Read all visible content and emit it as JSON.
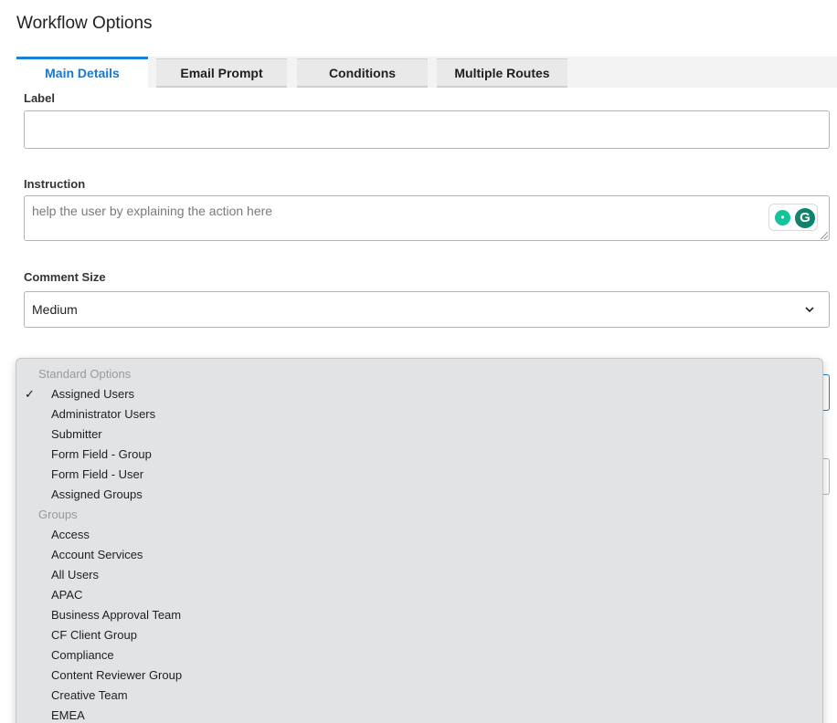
{
  "page": {
    "title": "Workflow Options"
  },
  "tabs": [
    {
      "label": "Main Details",
      "active": true
    },
    {
      "label": "Email Prompt",
      "active": false
    },
    {
      "label": "Conditions",
      "active": false
    },
    {
      "label": "Multiple Routes",
      "active": false
    }
  ],
  "form": {
    "label_field": {
      "label": "Label",
      "value": ""
    },
    "instruction_field": {
      "label": "Instruction",
      "placeholder": "help the user by explaining the action here"
    },
    "comment_size": {
      "label": "Comment Size",
      "value": "Medium"
    }
  },
  "dropdown": {
    "groups": [
      {
        "header": "Standard Options",
        "items": [
          {
            "label": "Assigned Users",
            "checked": true
          },
          {
            "label": "Administrator Users",
            "checked": false
          },
          {
            "label": "Submitter",
            "checked": false
          },
          {
            "label": "Form Field - Group",
            "checked": false
          },
          {
            "label": "Form Field - User",
            "checked": false
          },
          {
            "label": "Assigned Groups",
            "checked": false
          }
        ]
      },
      {
        "header": "Groups",
        "items": [
          {
            "label": "Access",
            "checked": false
          },
          {
            "label": "Account Services",
            "checked": false
          },
          {
            "label": "All Users",
            "checked": false
          },
          {
            "label": "APAC",
            "checked": false
          },
          {
            "label": "Business Approval Team",
            "checked": false
          },
          {
            "label": "CF Client Group",
            "checked": false
          },
          {
            "label": "Compliance",
            "checked": false
          },
          {
            "label": "Content Reviewer Group",
            "checked": false
          },
          {
            "label": "Creative Team",
            "checked": false
          },
          {
            "label": "EMEA",
            "checked": false
          }
        ]
      }
    ],
    "check_glyph": "✓"
  },
  "icons": {
    "grammarly_bulb": "grammarly-suggestion-icon",
    "grammarly_logo": "grammarly-logo-icon",
    "chevron": "chevron-down-icon"
  },
  "grammarly": {
    "letter": "G"
  },
  "colors": {
    "accent": "#1a82d4",
    "active_tab_text": "#1a78c9",
    "dropdown_bg": "#e2e3e5",
    "grammarly_green": "#15c39a"
  }
}
